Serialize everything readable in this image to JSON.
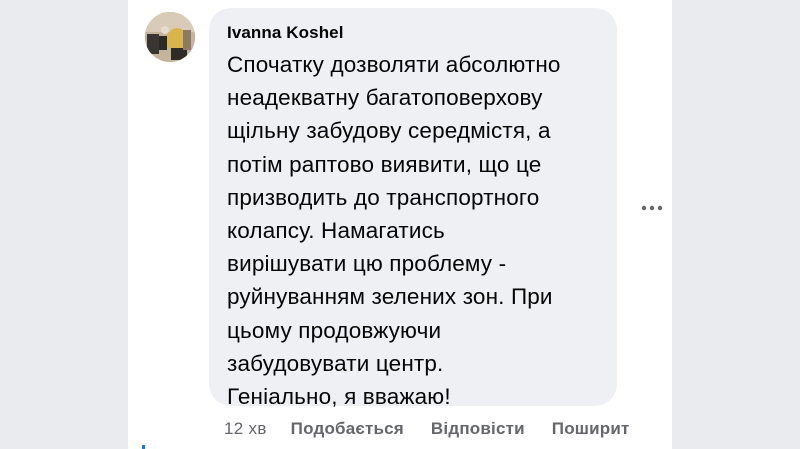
{
  "comment": {
    "author": "Ivanna Koshel",
    "text": "Спочатку дозволяти абсолютно\nнеадекватну багатоповерхову\nщільну забудову середмістя, а\nпотім раптово виявити, що це\nпризводить до транспортного\nколапсу. Намагатись\nвирішувати цю проблему -\nруйнуванням зелених зон. При\nцьому продовжуючи\nзабудовувати центр.\nГеніально, я вважаю!",
    "time": "12 хв",
    "actions": {
      "like": "Подобається",
      "reply": "Відповісти",
      "share": "Поширит"
    }
  },
  "icons": {
    "more": "more-horizontal-icon",
    "avatar": "user-avatar"
  },
  "colors": {
    "bubble": "#eef0f3",
    "text": "#050505",
    "secondary": "#65676b",
    "background": "#f0f2f5"
  }
}
